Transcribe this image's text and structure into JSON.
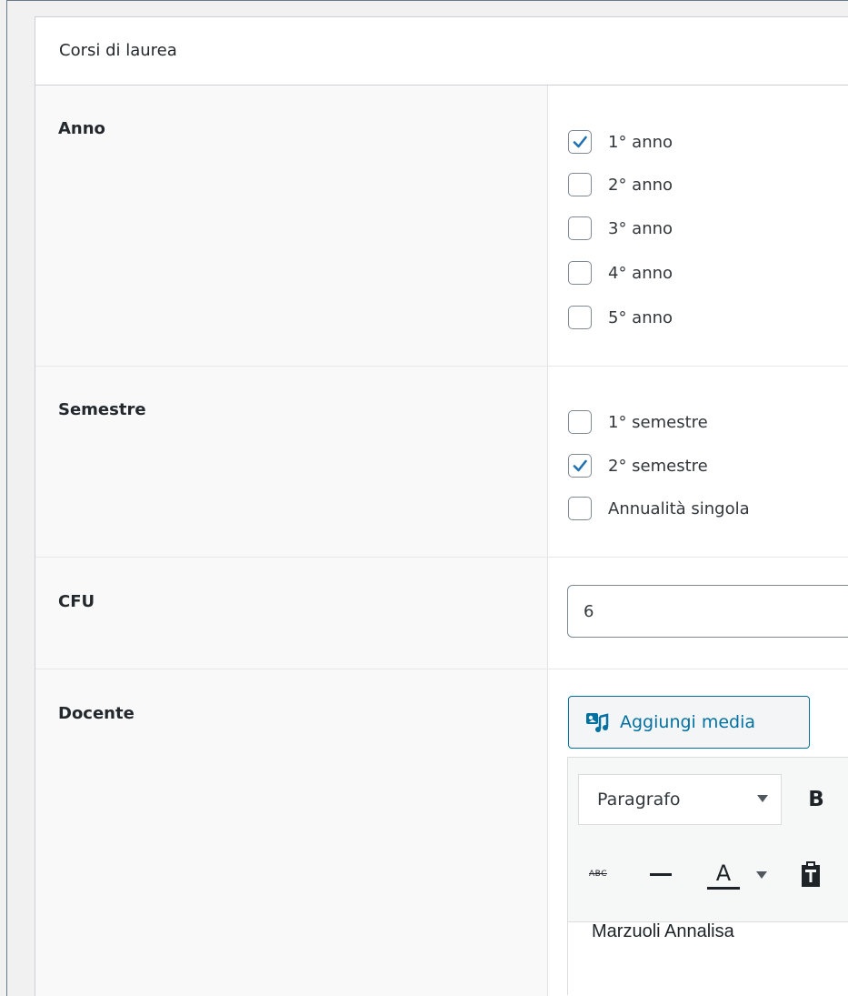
{
  "metabox": {
    "title": "Corsi di laurea"
  },
  "fields": {
    "anno": {
      "label": "Anno",
      "options": [
        {
          "label": "1° anno",
          "checked": true
        },
        {
          "label": "2° anno",
          "checked": false
        },
        {
          "label": "3° anno",
          "checked": false
        },
        {
          "label": "4° anno",
          "checked": false
        },
        {
          "label": "5° anno",
          "checked": false
        }
      ]
    },
    "semestre": {
      "label": "Semestre",
      "options": [
        {
          "label": "1° semestre",
          "checked": false
        },
        {
          "label": "2° semestre",
          "checked": true
        },
        {
          "label": "Annualità singola",
          "checked": false
        }
      ]
    },
    "cfu": {
      "label": "CFU",
      "value": "6"
    },
    "docente": {
      "label": "Docente",
      "add_media_label": "Aggiungi media",
      "editor": {
        "format_select": "Paragrafo",
        "bold_label": "B",
        "strikethrough_label": "ABC",
        "text_color_label": "A",
        "content": "Marzuoli Annalisa"
      }
    }
  },
  "colors": {
    "accent": "#0071a1",
    "checkmark": "#2271b1",
    "border": "#ccd0d4"
  },
  "icons": {
    "add_media": "media-icon",
    "strikethrough": "strikethrough-icon",
    "horizontal_line": "horizontal-line-icon",
    "text_color": "text-color-icon",
    "paste": "paste-as-text-icon",
    "dropdown": "chevron-down-icon"
  }
}
